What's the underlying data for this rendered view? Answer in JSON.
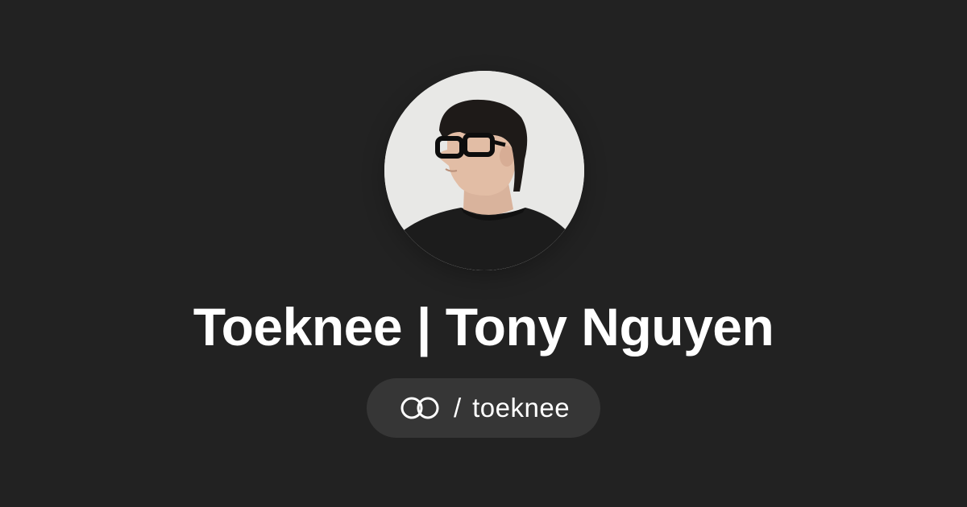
{
  "profile": {
    "display_name": "Toeknee | Tony Nguyen",
    "separator": "/",
    "handle": "toeknee"
  },
  "icons": {
    "avatar": "avatar-photo",
    "brand": "linked-rings-logo-icon"
  },
  "colors": {
    "background": "#222222",
    "pill_background": "#363636",
    "text": "#ffffff"
  }
}
